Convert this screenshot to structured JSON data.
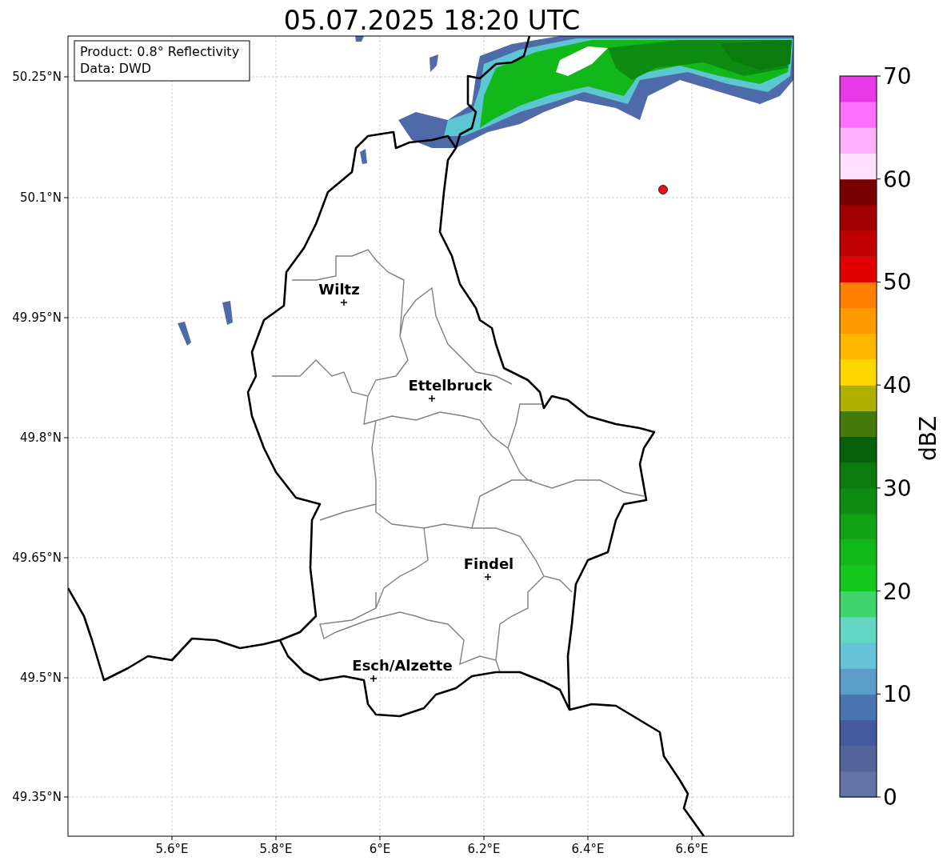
{
  "map": {
    "title": "05.07.2025 18:20 UTC",
    "legend": [
      "Product: 0.8° Reflectivity",
      "Data: DWD"
    ],
    "x_ticks": [
      "5.6°E",
      "5.8°E",
      "6°E",
      "6.2°E",
      "6.4°E",
      "6.6°E"
    ],
    "y_ticks": [
      "50.25°N",
      "50.1°N",
      "49.95°N",
      "49.8°N",
      "49.65°N",
      "49.5°N",
      "49.35°N"
    ],
    "cities": [
      {
        "name": "Wiltz"
      },
      {
        "name": "Ettelbruck"
      },
      {
        "name": "Findel"
      },
      {
        "name": "Esch/Alzette"
      }
    ]
  },
  "colorbar": {
    "label": "dBZ",
    "ticks": [
      "70",
      "60",
      "50",
      "40",
      "30",
      "20",
      "10",
      "0"
    ],
    "bins": [
      {
        "color": "#6473a6"
      },
      {
        "color": "#52649a"
      },
      {
        "color": "#44589e"
      },
      {
        "color": "#4875b0"
      },
      {
        "color": "#5b9dc8"
      },
      {
        "color": "#66c2d9"
      },
      {
        "color": "#63d6c4"
      },
      {
        "color": "#40d46c"
      },
      {
        "color": "#14c81e"
      },
      {
        "color": "#12b71a"
      },
      {
        "color": "#10a414"
      },
      {
        "color": "#0e8c12"
      },
      {
        "color": "#0b7a0f"
      },
      {
        "color": "#09600b"
      },
      {
        "color": "#457a0a"
      },
      {
        "color": "#b0b000"
      },
      {
        "color": "#ffd700"
      },
      {
        "color": "#ffb700"
      },
      {
        "color": "#ff9a00"
      },
      {
        "color": "#ff7f00"
      },
      {
        "color": "#e00000"
      },
      {
        "color": "#c00000"
      },
      {
        "color": "#a00000"
      },
      {
        "color": "#780000"
      },
      {
        "color": "#ffe0ff"
      },
      {
        "color": "#ffb0ff"
      },
      {
        "color": "#ff70ff"
      },
      {
        "color": "#e838e8"
      }
    ]
  }
}
